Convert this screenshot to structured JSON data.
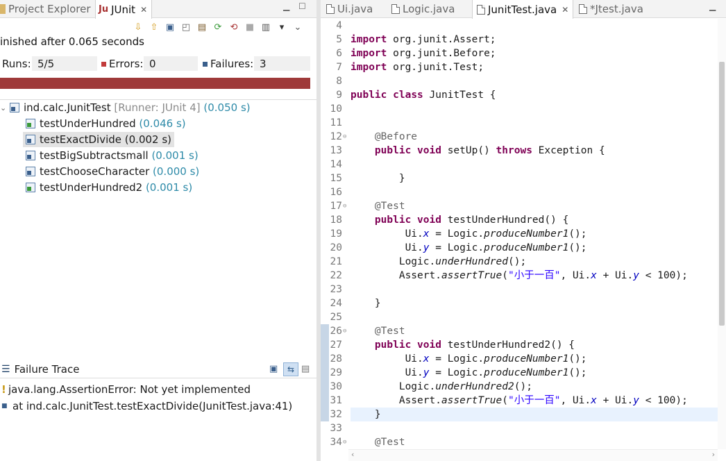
{
  "left_tabs": [
    {
      "label": "Project Explorer",
      "icon": "project-explorer-icon"
    },
    {
      "label": "JUnit",
      "icon": "junit-icon",
      "close": "✕"
    }
  ],
  "junit": {
    "status": "inished after 0.065 seconds",
    "runs_label": "Runs:",
    "runs_value": "5/5",
    "errors_label": "Errors:",
    "errors_value": "0",
    "failures_label": "Failures:",
    "failures_value": "3",
    "progress_color": "#9f3a3a",
    "progress": 1.0,
    "tree": [
      {
        "name": "ind.calc.JunitTest",
        "runner": "[Runner: JUnit 4]",
        "time": "(0.050 s)",
        "status": "failure"
      },
      {
        "name": "testUnderHundred",
        "time": "(0.046 s)",
        "status": "pass"
      },
      {
        "name": "testExactDivide",
        "time": "(0.002 s)",
        "status": "failure",
        "selected": true
      },
      {
        "name": "testBigSubtractsmall",
        "time": "(0.001 s)",
        "status": "failure"
      },
      {
        "name": "testChooseCharacter",
        "time": "(0.000 s)",
        "status": "failure"
      },
      {
        "name": "testUnderHundred2",
        "time": "(0.001 s)",
        "status": "pass"
      }
    ]
  },
  "failure_trace": {
    "title": "Failure Trace",
    "lines": [
      "java.lang.AssertionError: Not yet implemented",
      "at ind.calc.JunitTest.testExactDivide(JunitTest.java:41)"
    ]
  },
  "editor_tabs": [
    {
      "label": "Ui.java"
    },
    {
      "label": "Logic.java"
    },
    {
      "label": "JunitTest.java",
      "active": true,
      "close": "✕"
    },
    {
      "label": "*Jtest.java"
    }
  ],
  "editor": {
    "line_numbers": [
      "4",
      "5",
      "6",
      "7",
      "8",
      "9",
      "10",
      "11",
      "12",
      "13",
      "14",
      "15",
      "16",
      "17",
      "18",
      "19",
      "20",
      "21",
      "22",
      "23",
      "24",
      "25",
      "26",
      "27",
      "28",
      "29",
      "30",
      "31",
      "32",
      "33",
      "34"
    ],
    "strings": {
      "import": "import",
      "org_junit_assert": " org.junit.Assert;",
      "org_junit_before": " org.junit.Before;",
      "org_junit_test": " org.junit.Test;",
      "public": "public",
      "class": "class",
      "junittest_decl": " JunitTest {",
      "before_ann": "@Before",
      "void": "void",
      "setup": " setUp() ",
      "throws": "throws",
      "exception": " Exception {",
      "close_brace": "}",
      "test_ann": "@Test",
      "test_under_hundred": " testUnderHundred() {",
      "test_under_hundred2": " testUnderHundred2() {",
      "ui_dot": "Ui.",
      "x": "x",
      "y": "y",
      "eq_logic": " = Logic.",
      "produce_number": "produceNumber1",
      "call_end": "();",
      "logic_dot": "Logic.",
      "under_hundred": "underHundred",
      "under_hundred2": "underHundred2",
      "assert_dot": "Assert.",
      "assert_true": "assertTrue",
      "open_paren": "(",
      "chinese_str": "\"小于一百\"",
      "comma_ui": ", Ui.",
      "plus_ui": " + Ui.",
      "lt_100": " < 100);"
    }
  }
}
